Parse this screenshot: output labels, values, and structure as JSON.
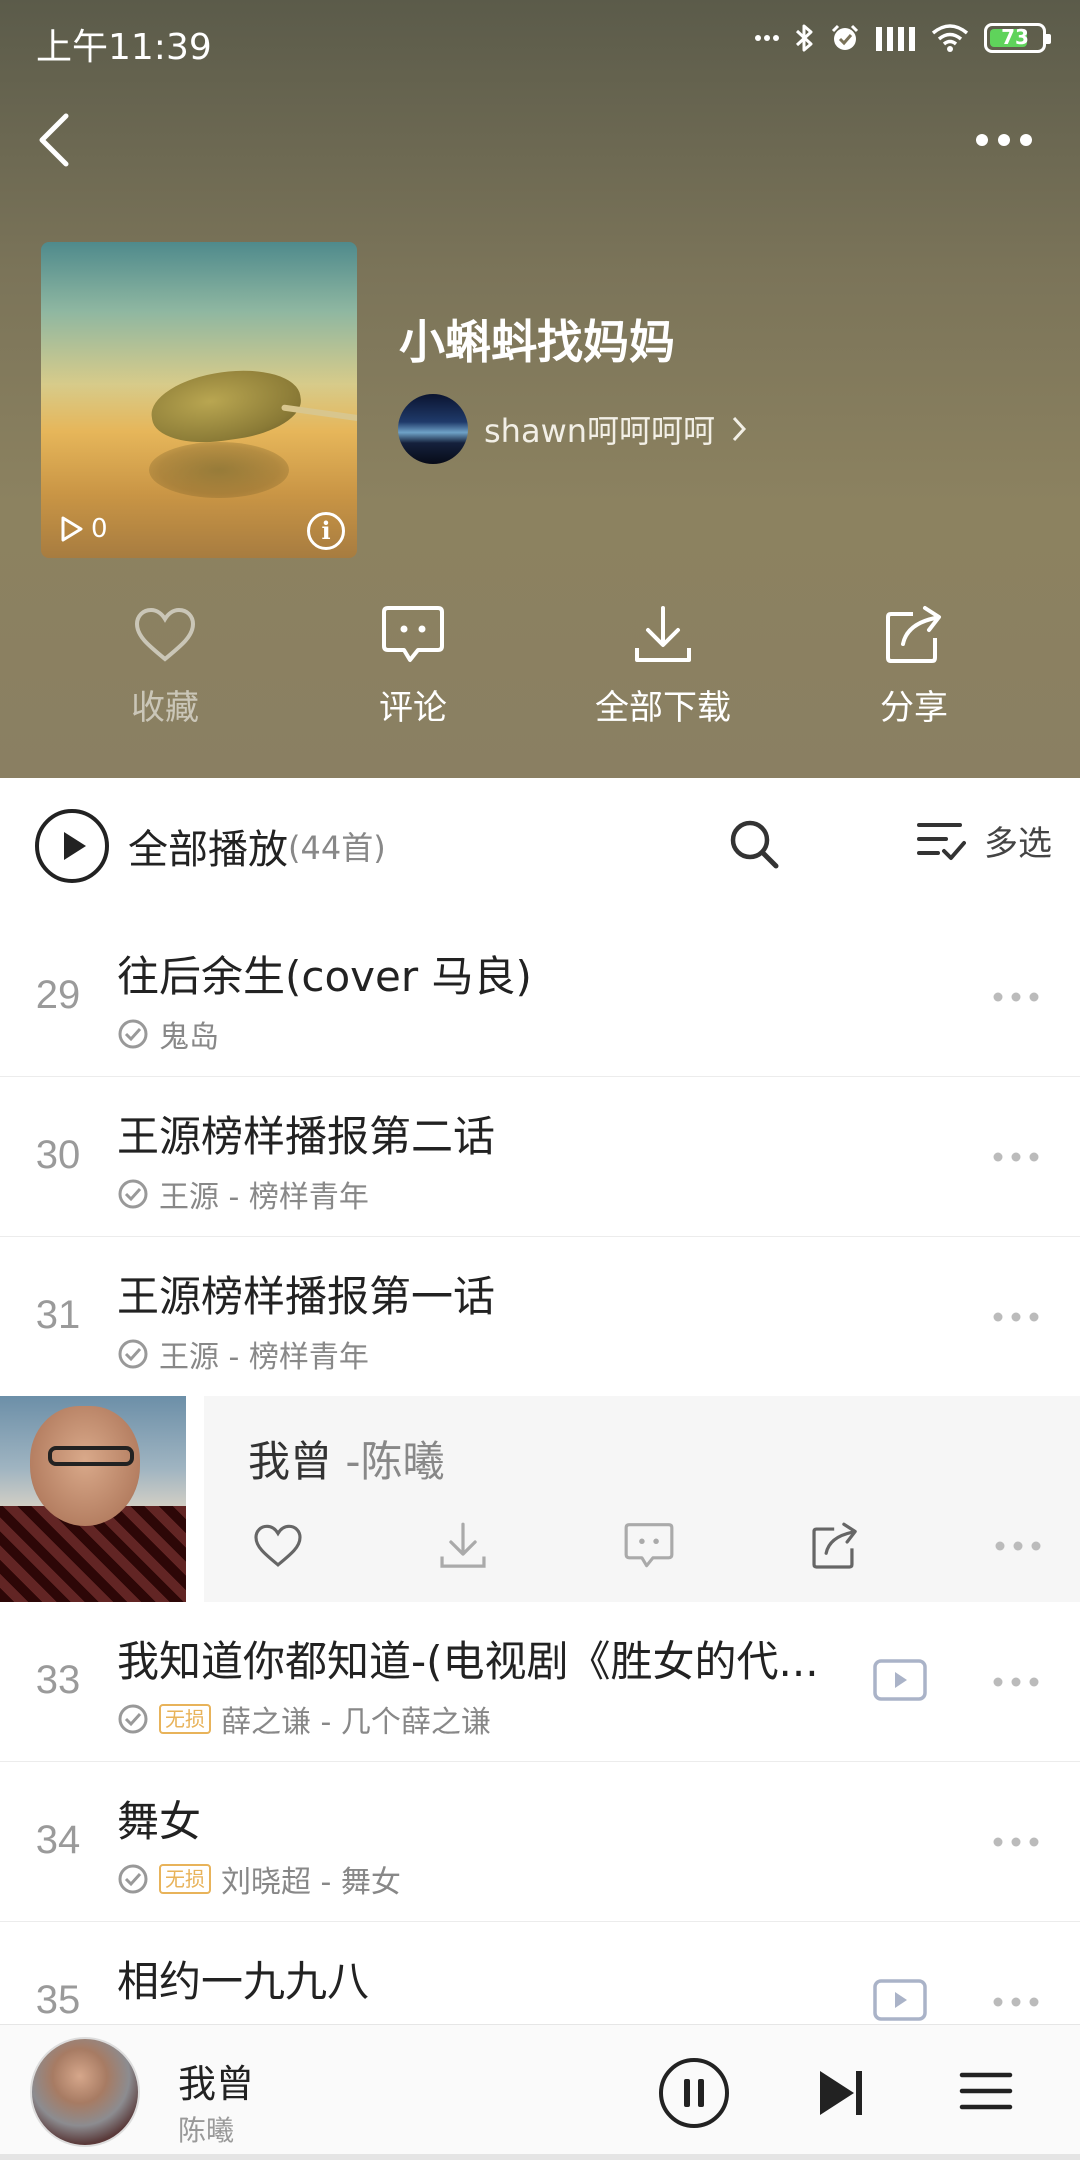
{
  "status_bar": {
    "time": "上午11:39",
    "battery": "73",
    "battery_level": 0.73
  },
  "playlist": {
    "title": "小蝌蚪找妈妈",
    "owner": "shawn呵呵呵呵",
    "owner_chevron": ">",
    "play_count": "0"
  },
  "actions": [
    {
      "label": "收藏",
      "icon": "heart-icon"
    },
    {
      "label": "评论",
      "icon": "comment-icon"
    },
    {
      "label": "全部下载",
      "icon": "download-icon"
    },
    {
      "label": "分享",
      "icon": "share-icon"
    }
  ],
  "play_all": {
    "label": "全部播放",
    "count": "(44首)",
    "multi_select": "多选"
  },
  "songs": [
    {
      "num": "29",
      "title": "往后余生(cover 马良)",
      "subtitle": "鬼岛",
      "lossless": false,
      "mv": false
    },
    {
      "num": "30",
      "title": "王源榜样播报第二话",
      "subtitle": "王源 - 榜样青年",
      "lossless": false,
      "mv": false
    },
    {
      "num": "31",
      "title": "王源榜样播报第一话",
      "subtitle": "王源 - 榜样青年",
      "lossless": false,
      "mv": false
    },
    {
      "num": "33",
      "title": "我知道你都知道-(电视剧《胜女的代...",
      "subtitle": "薛之谦 - 几个薛之谦",
      "lossless": true,
      "mv": true
    },
    {
      "num": "34",
      "title": "舞女",
      "subtitle": "刘晓超 - 舞女",
      "lossless": true,
      "mv": false
    },
    {
      "num": "35",
      "title": "相约一九九八",
      "subtitle": "",
      "lossless": false,
      "mv": true
    }
  ],
  "lossless_badge": "无损",
  "expanded_song": {
    "title": "我曾 ",
    "artist": "-陈曦"
  },
  "mini_player": {
    "title": "我曾",
    "artist": "陈曦",
    "progress": 0.0
  },
  "colors": {
    "accent_green": "#5fd35b",
    "lossless": "#e8b35a"
  }
}
